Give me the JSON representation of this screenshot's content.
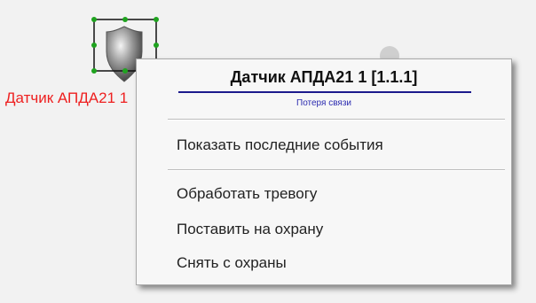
{
  "canvas": {
    "sensor_label": "Датчик АПДА21 1"
  },
  "context_menu": {
    "title": "Датчик АПДА21 1 [1.1.1]",
    "status": "Потеря связи",
    "items": [
      {
        "label": "Показать последние события"
      },
      {
        "label": "Обработать тревогу"
      },
      {
        "label": "Поставить на охрану"
      },
      {
        "label": "Снять с охраны"
      }
    ]
  },
  "colors": {
    "sensor_label": "#ee2020",
    "title_underline": "#1c1a8c",
    "status_text": "#2b2bb0",
    "selection_handles": "#1fa31f"
  },
  "icons": {
    "sensor": "shield-sensor-icon"
  }
}
